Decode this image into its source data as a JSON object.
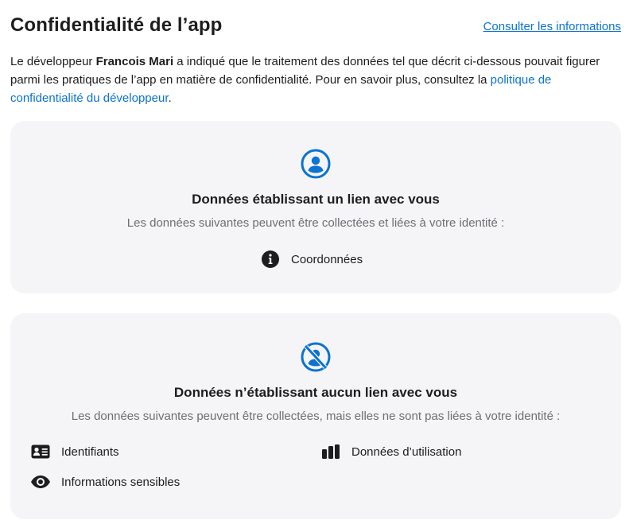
{
  "header": {
    "title": "Confidentialité de l’app",
    "link": "Consulter les informations"
  },
  "intro": {
    "part1": "Le développeur ",
    "developer": "Francois Mari",
    "part2": " a indiqué que le traitement des données tel que décrit ci-dessous pouvait figurer parmi les pratiques de l’app en matière de confidentialité. Pour en savoir plus, consultez la ",
    "policy_link": "politique de confidentialité du développeur",
    "part3": "."
  },
  "linked_card": {
    "icon": "person-circle-icon",
    "title": "Données établissant un lien avec vous",
    "subtitle": "Les données suivantes peuvent être collectées et liées à votre identité :",
    "items": [
      {
        "icon": "info-circle-icon",
        "label": "Coordonnées"
      }
    ]
  },
  "not_linked_card": {
    "icon": "person-slash-icon",
    "title": "Données n’établissant aucun lien avec vous",
    "subtitle": "Les données suivantes peuvent être collectées, mais elles ne sont pas liées à votre identité :",
    "items": [
      {
        "icon": "id-card-icon",
        "label": "Identifiants"
      },
      {
        "icon": "bar-chart-icon",
        "label": "Données d’utilisation"
      },
      {
        "icon": "eye-icon",
        "label": "Informations sensibles"
      }
    ]
  },
  "colors": {
    "accent": "#0b73d1",
    "card_bg": "#f5f5f7",
    "text": "#1d1d1f",
    "muted": "#6e6e73"
  }
}
